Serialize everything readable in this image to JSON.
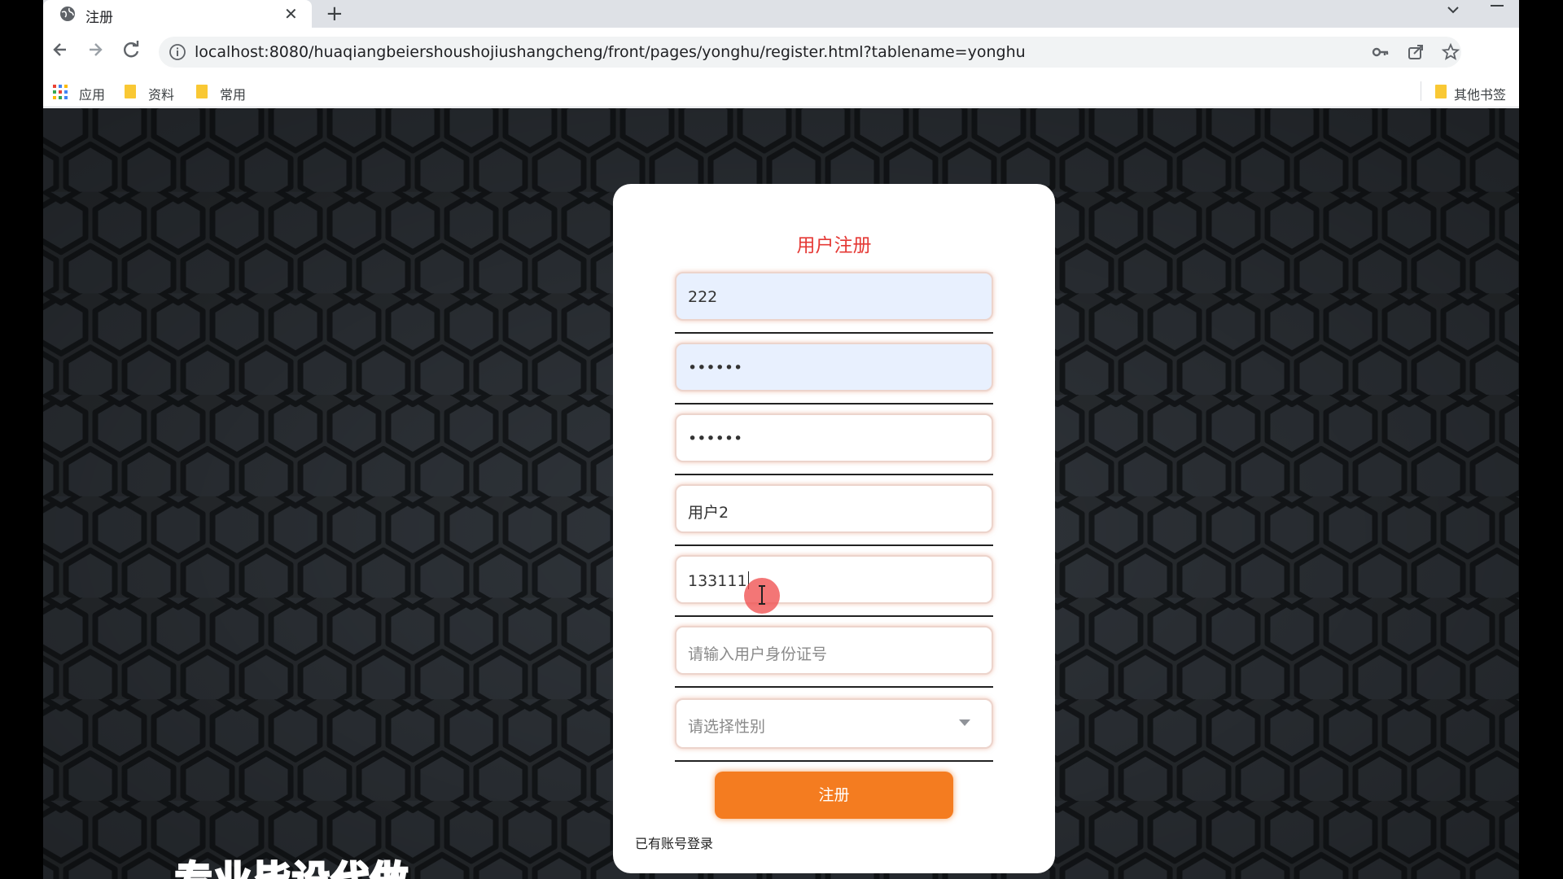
{
  "browser": {
    "tab": {
      "title": "注册",
      "close_icon": "close-icon",
      "favicon": "globe-icon"
    },
    "new_tab_label": "+",
    "url": "localhost:8080/huaqiangbeiershoushojiushangcheng/front/pages/yonghu/register.html?tablename=yonghu",
    "bookmarks": {
      "apps_label": "应用",
      "folder1_label": "资料",
      "folder2_label": "常用",
      "other_label": "其他书签"
    }
  },
  "form": {
    "title": "用户注册",
    "account": {
      "value": "222"
    },
    "password": {
      "value": "••••••"
    },
    "confirm_password": {
      "value": "••••••"
    },
    "name": {
      "value": "用户2"
    },
    "phone": {
      "value": "133111"
    },
    "id_card": {
      "placeholder": "请输入用户身份证号"
    },
    "gender": {
      "placeholder": "请选择性别"
    },
    "register_button": "注册",
    "login_link": "已有账号登录"
  },
  "colors": {
    "title_red": "#e53935",
    "button_orange": "#f47c20",
    "background": "#2b2f33"
  },
  "overlay_text": "专业毕设代做"
}
